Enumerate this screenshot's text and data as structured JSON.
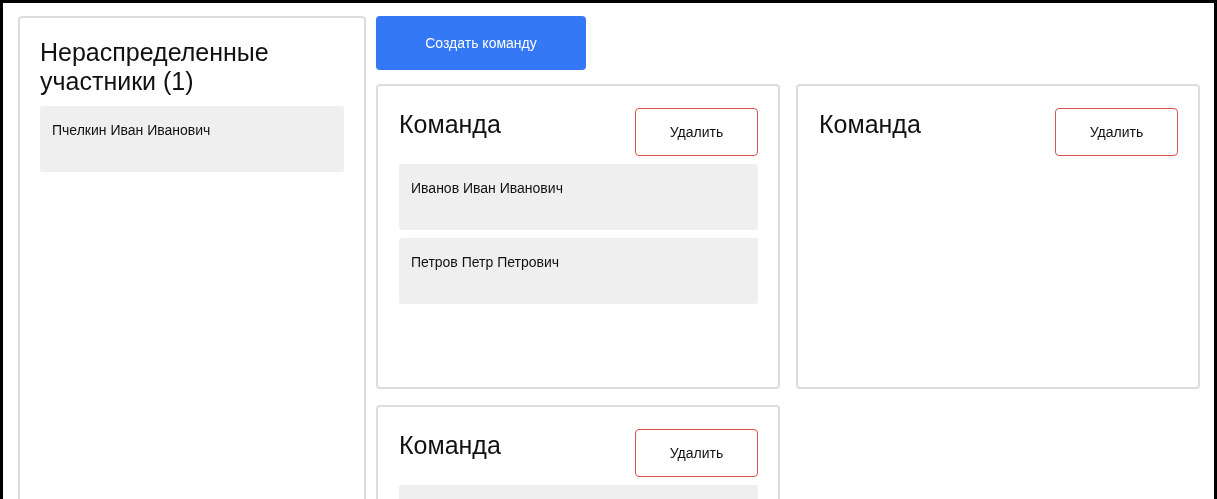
{
  "unassigned": {
    "title": "Нераспределенные участники (1)",
    "members": [
      "Пчелкин Иван Иванович"
    ]
  },
  "create_button": "Создать команду",
  "teams": [
    {
      "title": "Команда",
      "delete_button": "Удалить",
      "members": [
        "Иванов Иван Иванович",
        "Петров Петр Петрович"
      ],
      "partial_member": false
    },
    {
      "title": "Команда",
      "delete_button": "Удалить",
      "partial_member": false
    },
    {
      "title": "Команда",
      "delete_button": "Удалить",
      "partial_member": true
    }
  ]
}
